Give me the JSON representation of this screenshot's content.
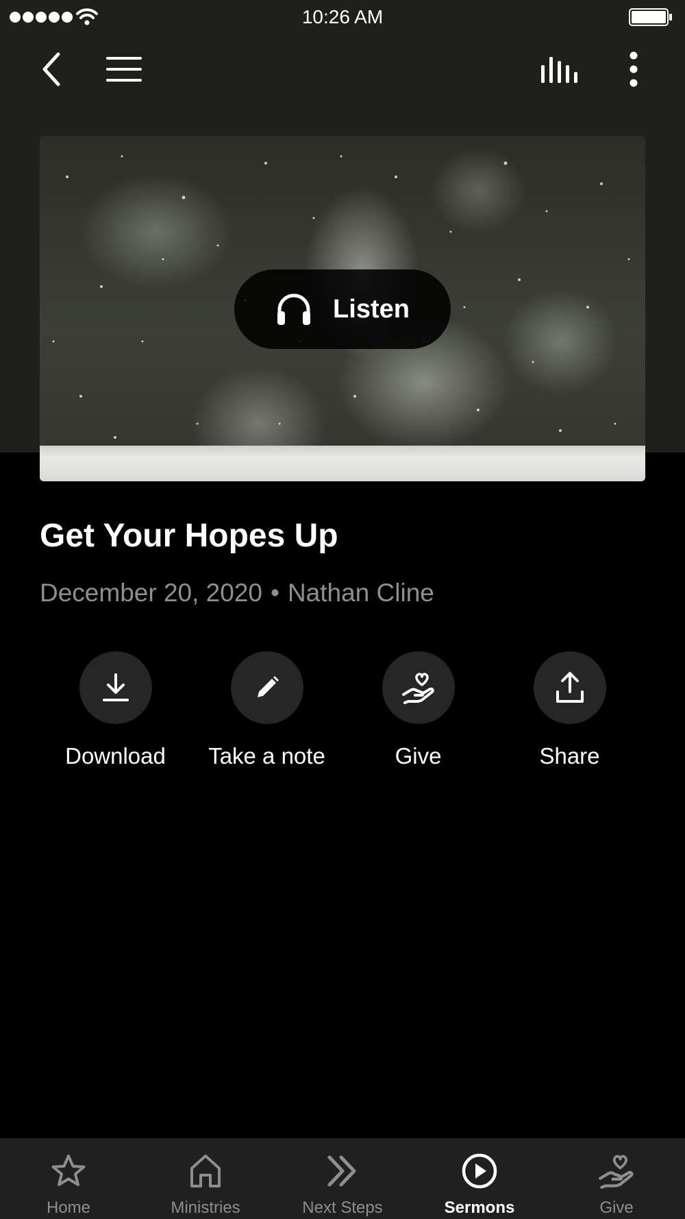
{
  "status_bar": {
    "time": "10:26 AM",
    "signal_icon": "signal-dots-icon",
    "wifi_icon": "wifi-icon",
    "battery_icon": "battery-icon"
  },
  "nav": {
    "back_icon": "chevron-left-icon",
    "menu_icon": "hamburger-menu-icon",
    "audio_icon": "audio-bars-icon",
    "more_icon": "more-vertical-icon"
  },
  "hero": {
    "listen_label": "Listen",
    "listen_icon": "headphones-icon"
  },
  "sermon": {
    "title": "Get Your Hopes Up",
    "date": "December 20, 2020",
    "separator": "•",
    "speaker": "Nathan Cline"
  },
  "actions": [
    {
      "label": "Download",
      "icon": "download-icon"
    },
    {
      "label": "Take a note",
      "icon": "pencil-icon"
    },
    {
      "label": "Give",
      "icon": "heart-hand-icon"
    },
    {
      "label": "Share",
      "icon": "share-icon"
    }
  ],
  "tab_bar": {
    "tabs": [
      {
        "label": "Home",
        "icon": "star-icon",
        "active": false
      },
      {
        "label": "Ministries",
        "icon": "house-icon",
        "active": false
      },
      {
        "label": "Next Steps",
        "icon": "double-chevron-right-icon",
        "active": false
      },
      {
        "label": "Sermons",
        "icon": "play-circle-icon",
        "active": true
      },
      {
        "label": "Give",
        "icon": "heart-hand-icon",
        "active": false
      }
    ]
  },
  "colors": {
    "background": "#000000",
    "header_band": "#1f1f1c",
    "meta_text": "#8f8f8f",
    "action_circle": "#262626",
    "tab_bar": "#202020",
    "tab_inactive": "#8e8e8e",
    "tab_active": "#ffffff"
  }
}
